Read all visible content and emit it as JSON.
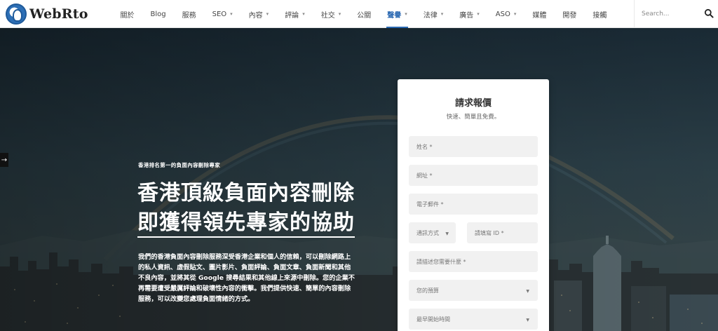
{
  "brand": {
    "name": "WebRto"
  },
  "nav": {
    "items": [
      {
        "label": "關於",
        "dropdown": false,
        "active": false
      },
      {
        "label": "Blog",
        "dropdown": false,
        "active": false
      },
      {
        "label": "服務",
        "dropdown": false,
        "active": false
      },
      {
        "label": "SEO",
        "dropdown": true,
        "active": false
      },
      {
        "label": "內容",
        "dropdown": true,
        "active": false
      },
      {
        "label": "評論",
        "dropdown": true,
        "active": false
      },
      {
        "label": "社交",
        "dropdown": true,
        "active": false
      },
      {
        "label": "公關",
        "dropdown": false,
        "active": false
      },
      {
        "label": "聲譽",
        "dropdown": true,
        "active": true
      },
      {
        "label": "法律",
        "dropdown": true,
        "active": false
      },
      {
        "label": "廣告",
        "dropdown": true,
        "active": false
      },
      {
        "label": "ASO",
        "dropdown": true,
        "active": false
      },
      {
        "label": "媒體",
        "dropdown": false,
        "active": false
      },
      {
        "label": "開發",
        "dropdown": false,
        "active": false
      },
      {
        "label": "接觸",
        "dropdown": false,
        "active": false
      }
    ],
    "search_placeholder": "Search..."
  },
  "hero": {
    "eyebrow": "香港排名第一的負面內容刪除專家",
    "headline_line1": "香港頂級負面內容刪除",
    "headline_line2": "即獲得領先專家的協助",
    "description": "我們的香港負面內容刪除服務深受香港企業和個人的信賴，可以刪除網路上的私人資訊、虛假貼文、圖片影片、負面評論、負面文章、負面新聞和其他不良內容，並將其從 Google 搜尋結果和其他線上來源中刪除。您的企業不再需要遭受嚴厲評論和破壞性內容的衝擊。我們提供快速、簡單的內容刪除服務，可以改變您處理負面情緒的方式。"
  },
  "quote_form": {
    "title": "請求報價",
    "subtitle": "快速、簡單且免費。",
    "name_placeholder": "姓名 *",
    "website_placeholder": "網址 *",
    "email_placeholder": "電子郵件 *",
    "contact_method_label": "通訊方式",
    "contact_id_placeholder": "請填寫 ID *",
    "needs_placeholder": "請描述您需要什麼 *",
    "budget_label": "您的預算",
    "start_time_label": "最早開始時間"
  },
  "colors": {
    "accent": "#2a68b2",
    "text": "#444444"
  }
}
